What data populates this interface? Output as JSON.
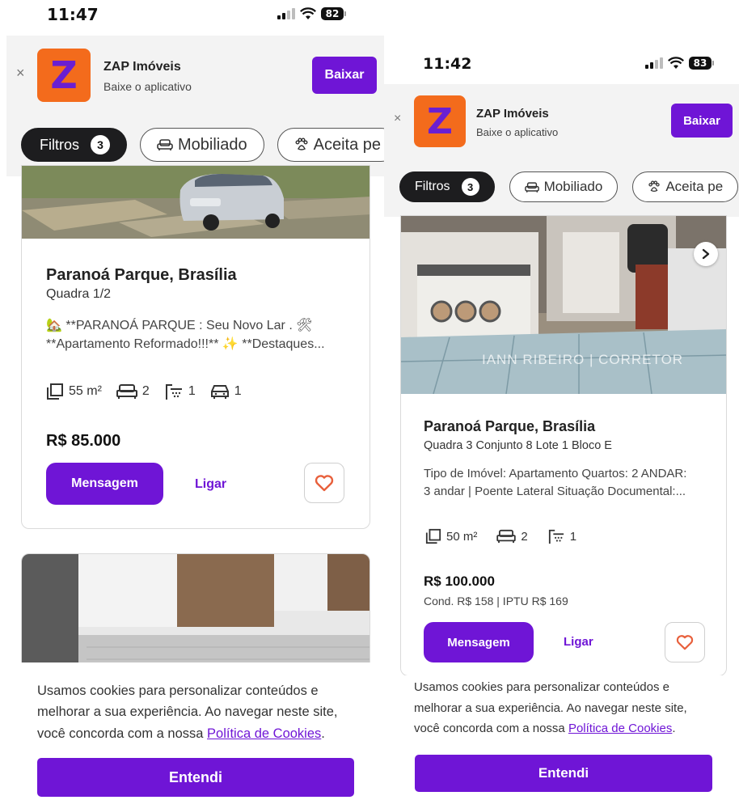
{
  "left": {
    "status": {
      "time": "11:47",
      "battery": "82"
    },
    "banner": {
      "close": "×",
      "app_name": "ZAP Imóveis",
      "app_subtitle": "Baixe o aplicativo",
      "download_label": "Baixar"
    },
    "filters": {
      "filters_label": "Filtros",
      "filters_count": "3",
      "furnished_label": "Mobiliado",
      "pets_label": "Aceita pe"
    },
    "card1": {
      "title": "Paranoá Parque, Brasília",
      "subtitle": "Quadra 1/2",
      "desc_line1": "🏡 **PARANOÁ PARQUE : Seu Novo Lar . 🛠",
      "desc_line2": "**Apartamento Reformado!!!** ✨ **Destaques...",
      "area": "55 m²",
      "bedrooms": "2",
      "bathrooms": "1",
      "parking": "1",
      "price": "R$ 85.000",
      "message_label": "Mensagem",
      "call_label": "Ligar"
    },
    "cookie": {
      "text_before": "Usamos cookies para personalizar conteúdos e melhorar a sua experiência. Ao navegar neste site, você concorda com a nossa ",
      "link": "Política de Cookies",
      "text_after": ".",
      "button": "Entendi"
    }
  },
  "right": {
    "status": {
      "time": "11:42",
      "battery": "83"
    },
    "banner": {
      "close": "×",
      "app_name": "ZAP Imóveis",
      "app_subtitle": "Baixe o aplicativo",
      "download_label": "Baixar"
    },
    "filters": {
      "filters_label": "Filtros",
      "filters_count": "3",
      "furnished_label": "Mobiliado",
      "pets_label": "Aceita pe"
    },
    "card": {
      "watermark": "IANN RIBEIRO | CORRETOR",
      "title": "Paranoá Parque, Brasília",
      "subtitle": "Quadra 3 Conjunto 8 Lote 1 Bloco E",
      "desc_line1": "Tipo de Imóvel: Apartamento Quartos: 2 ANDAR:",
      "desc_line2": "3 andar | Poente Lateral Situação Documental:...",
      "area": "50 m²",
      "bedrooms": "2",
      "bathrooms": "1",
      "price": "R$ 100.000",
      "fees": "Cond. R$ 158 | IPTU R$ 169",
      "message_label": "Mensagem",
      "call_label": "Ligar"
    },
    "cookie": {
      "text_before": "Usamos cookies para personalizar conteúdos e melhorar a sua experiência. Ao navegar neste site, você concorda com a nossa ",
      "link": "Política de Cookies",
      "text_after": ".",
      "button": "Entendi"
    }
  },
  "colors": {
    "brand_purple": "#6f15d6",
    "logo_orange": "#f36b1c",
    "chip_dark": "#1d1d1f",
    "favorite_heart": "#e8603c"
  },
  "icons": {
    "area": "floor-area-icon",
    "bed": "bed-icon",
    "shower": "shower-icon",
    "car": "car-icon",
    "sofa": "sofa-icon",
    "paw": "paw-icon",
    "heart": "heart-outline-icon",
    "next": "chevron-right-icon"
  }
}
